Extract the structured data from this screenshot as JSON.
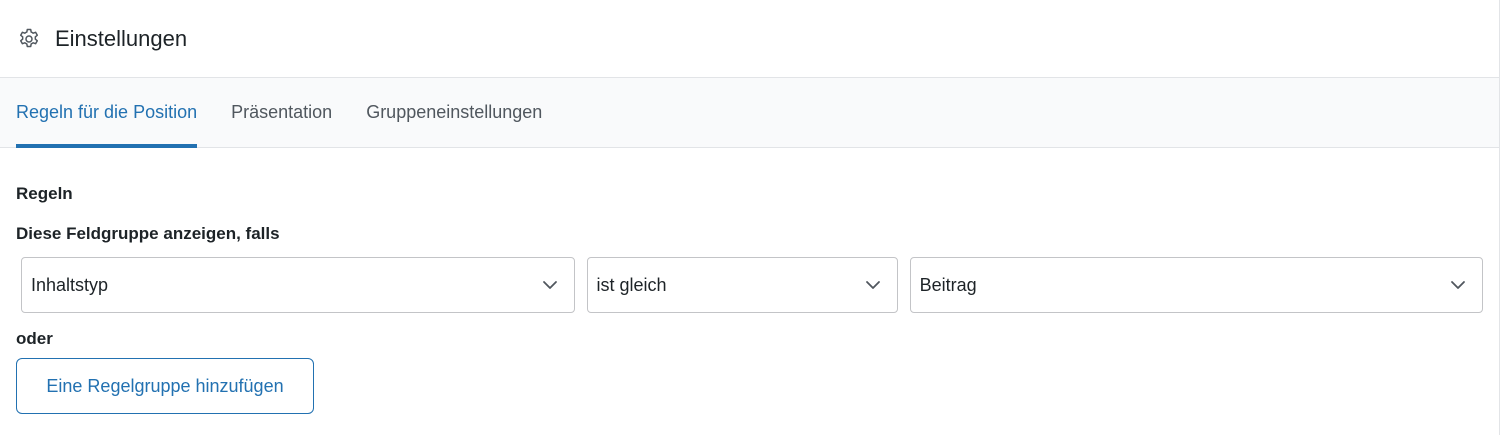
{
  "header": {
    "title": "Einstellungen",
    "icon": "gear-icon"
  },
  "tabs": [
    {
      "label": "Regeln für die Position",
      "active": true
    },
    {
      "label": "Präsentation",
      "active": false
    },
    {
      "label": "Gruppeneinstellungen",
      "active": false
    }
  ],
  "rules": {
    "section_label": "Regeln",
    "condition_label": "Diese Feldgruppe anzeigen, falls",
    "row": {
      "param": "Inhaltstyp",
      "operator": "ist gleich",
      "value": "Beitrag"
    },
    "or_label": "oder",
    "add_group_label": "Eine Regelgruppe hinzufügen"
  },
  "colors": {
    "accent": "#2271b1",
    "text": "#1d2327",
    "muted": "#50575e",
    "border": "#c3c4c7"
  }
}
